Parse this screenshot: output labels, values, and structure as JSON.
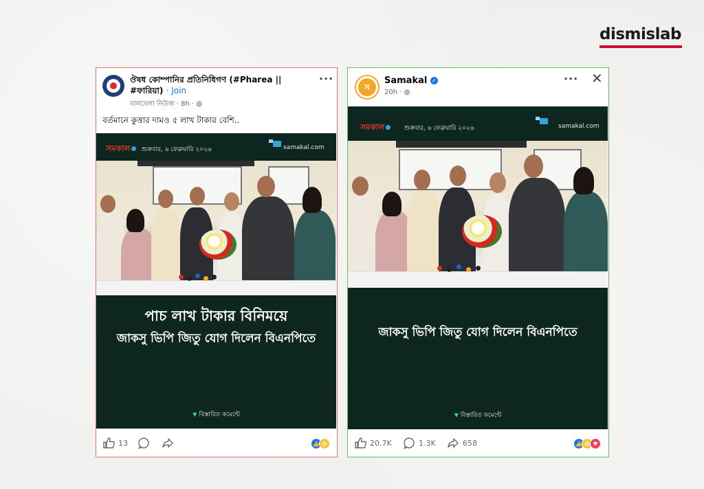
{
  "brand": {
    "name": "dismislab",
    "bar_color": "#c8102e"
  },
  "left_post": {
    "group_name": "ঔষধ কোম্পানির প্রতিনিধিগণ (#Pharea ||",
    "group_name_line2": "#ফারিয়া)",
    "join_label": "Join",
    "author": "বালবেলা নিউজ",
    "time": "8h",
    "caption": "বর্তমানে কুত্তার দামও ৫ লাখ টাকার বেশি..",
    "image": {
      "logo": "সমকাল",
      "date": "শুক্রবার, ৬ ফেব্রুয়ারি ২০২৬",
      "site": "samakal.com",
      "headline_line1": "পাচ লাখ টাকার বিনিময়ে",
      "headline_line2": "জাকসু ভিপি জিতু যোগ দিলেন বিএনপিতে",
      "see_more": "বিস্তারিত কমেন্টে"
    },
    "likes": "13",
    "border_color": "#e57373"
  },
  "right_post": {
    "page_name": "Samakal",
    "time": "20h",
    "image": {
      "logo": "সমকাল",
      "date": "শুক্রবার, ৬ ফেব্রুয়ারি ২০২৬",
      "site": "samakal.com",
      "headline": "জাকসু ভিপি জিতু যোগ দিলেন বিএনপিতে",
      "see_more": "বিস্তারিত কমেন্টে"
    },
    "likes": "20.7K",
    "comments": "1.3K",
    "shares": "658",
    "border_color": "#66bb6a"
  },
  "colors": {
    "post_bg": "#0d2620",
    "fb_blue": "#1877f2",
    "accent_green": "#3ddc84"
  }
}
